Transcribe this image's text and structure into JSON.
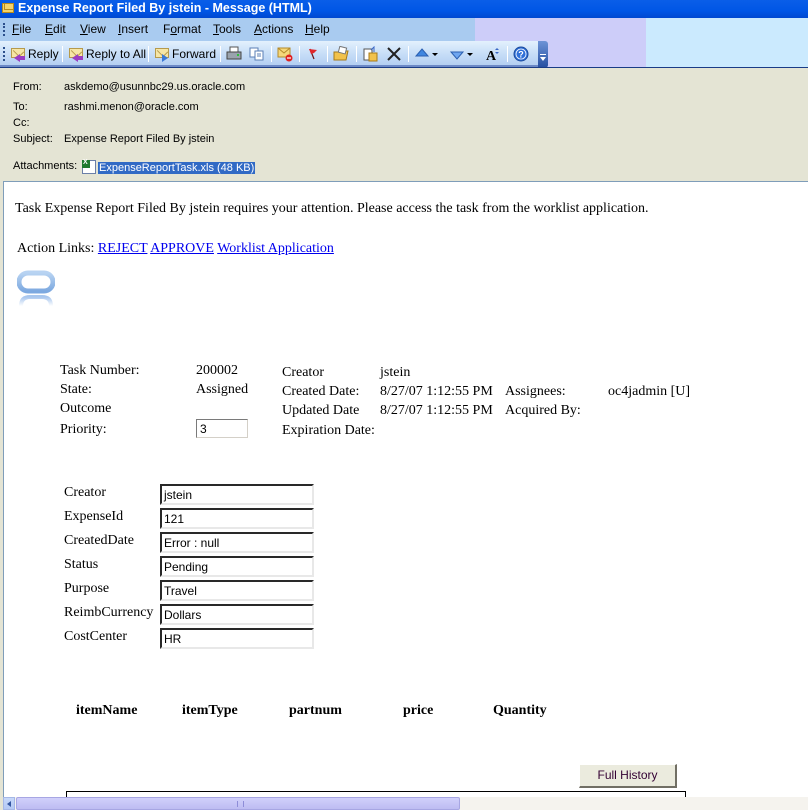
{
  "window": {
    "title": "Expense Report Filed By jstein - Message (HTML)"
  },
  "menu": {
    "items": [
      {
        "label": "File",
        "accel": "F",
        "rest": "ile"
      },
      {
        "label": "Edit",
        "accel": "E",
        "rest": "dit"
      },
      {
        "label": "View",
        "accel": "V",
        "rest": "iew"
      },
      {
        "label": "Insert",
        "accel": "I",
        "rest": "nsert"
      },
      {
        "label": "Format",
        "accel": "o",
        "pre": "F",
        "rest": "rmat"
      },
      {
        "label": "Tools",
        "accel": "T",
        "rest": "ools"
      },
      {
        "label": "Actions",
        "accel": "A",
        "rest": "ctions"
      },
      {
        "label": "Help",
        "accel": "H",
        "rest": "elp"
      }
    ]
  },
  "toolbar": {
    "reply_label": "Reply",
    "reply_all_label": "Reply to All",
    "forward_label": "Forward",
    "icons": [
      "print-icon",
      "copy-icon",
      "junk-mail-icon",
      "flag-icon",
      "move-to-folder-icon",
      "options-icon",
      "delete-icon",
      "previous-item-icon",
      "next-item-icon",
      "font-size-icon",
      "help-icon"
    ]
  },
  "header": {
    "from_label": "From:",
    "from_value": "askdemo@usunnbc29.us.oracle.com",
    "to_label": "To:",
    "to_value": "rashmi.menon@oracle.com",
    "cc_label": "Cc:",
    "cc_value": "",
    "subject_label": "Subject:",
    "subject_value": "Expense Report Filed By jstein",
    "attachments_label": "Attachments:",
    "attachment_name": "ExpenseReportTask.xls (48 KB)"
  },
  "body": {
    "message": "Task Expense Report Filed By jstein requires your attention. Please access the task from the worklist application.",
    "action_links_label": "Action Links:",
    "links": {
      "reject": "REJECT",
      "approve": "APPROVE",
      "worklist": "Worklist Application"
    },
    "task": {
      "task_number_label": "Task Number:",
      "task_number": "200002",
      "state_label": "State:",
      "state": "Assigned",
      "outcome_label": "Outcome",
      "outcome": "",
      "priority_label": "Priority:",
      "priority": "3",
      "creator_label": "Creator",
      "creator": "jstein",
      "created_date_label": "Created Date:",
      "created_date": "8/27/07 1:12:55 PM",
      "updated_date_label": "Updated Date",
      "updated_date": "8/27/07 1:12:55 PM",
      "expiration_date_label": "Expiration Date:",
      "expiration_date": "",
      "assignees_label": "Assignees:",
      "assignees": "oc4jadmin [U]",
      "acquired_by_label": "Acquired By:",
      "acquired_by": ""
    },
    "payload": [
      {
        "label": "Creator",
        "value": "jstein"
      },
      {
        "label": "ExpenseId",
        "value": "121"
      },
      {
        "label": "CreatedDate",
        "value": "Error : null"
      },
      {
        "label": "Status",
        "value": "Pending"
      },
      {
        "label": "Purpose",
        "value": "Travel"
      },
      {
        "label": "ReimbCurrency",
        "value": "Dollars"
      },
      {
        "label": "CostCenter",
        "value": "HR"
      }
    ],
    "item_columns": [
      "itemName",
      "itemType",
      "partnum",
      "price",
      "Quantity"
    ],
    "full_history_label": "Full History"
  },
  "colors": {
    "titlebar": "#0056e6",
    "link": "#0000ee",
    "header_bg": "#e4e4d4",
    "selection": "#316ac5"
  }
}
